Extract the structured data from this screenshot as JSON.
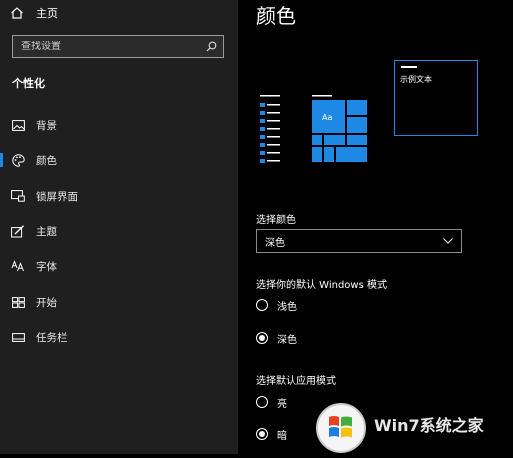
{
  "sidebar": {
    "home_label": "主页",
    "search_placeholder": "查找设置",
    "section_title": "个性化",
    "items": [
      {
        "label": "背景",
        "icon": "picture-icon"
      },
      {
        "label": "颜色",
        "icon": "palette-icon",
        "active": true
      },
      {
        "label": "锁屏界面",
        "icon": "lock-screen-icon"
      },
      {
        "label": "主题",
        "icon": "theme-brush-icon"
      },
      {
        "label": "字体",
        "icon": "font-icon"
      },
      {
        "label": "开始",
        "icon": "start-tiles-icon"
      },
      {
        "label": "任务栏",
        "icon": "taskbar-icon"
      }
    ]
  },
  "main": {
    "title": "颜色",
    "preview": {
      "tile_text": "Aa",
      "sample_text": "示例文本",
      "accent_color": "#1e88e5"
    },
    "choose_color": {
      "label": "选择颜色",
      "value": "深色"
    },
    "windows_mode": {
      "label": "选择你的默认 Windows 模式",
      "options": [
        {
          "label": "浅色",
          "selected": false
        },
        {
          "label": "深色",
          "selected": true
        }
      ]
    },
    "app_mode": {
      "label": "选择默认应用模式",
      "options": [
        {
          "label": "亮",
          "selected": false
        },
        {
          "label": "暗",
          "selected": true
        }
      ]
    }
  },
  "watermark": {
    "text": "Win7系统之家"
  }
}
